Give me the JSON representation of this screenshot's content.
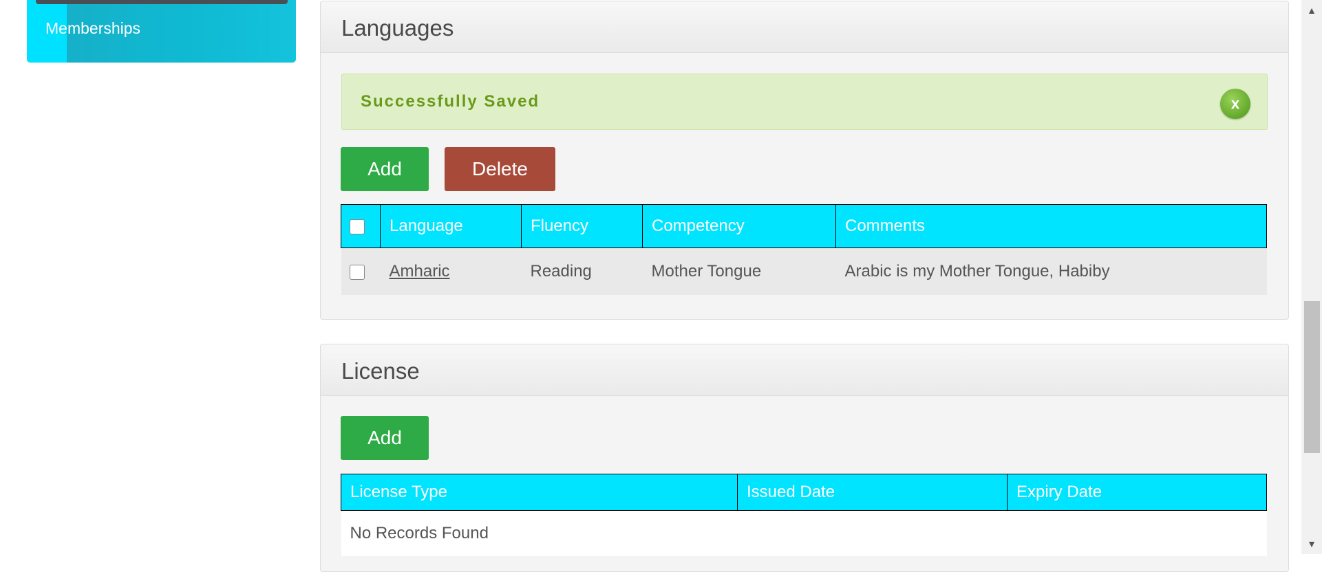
{
  "sidebar": {
    "items": [
      {
        "label": "Memberships"
      }
    ]
  },
  "languages": {
    "title": "Languages",
    "alert": {
      "message": "Successfully Saved",
      "close_symbol": "x"
    },
    "add_label": "Add",
    "delete_label": "Delete",
    "columns": [
      "",
      "Language",
      "Fluency",
      "Competency",
      "Comments"
    ],
    "rows": [
      {
        "language": "Amharic",
        "fluency": "Reading",
        "competency": "Mother Tongue",
        "comments": "Arabic is my Mother Tongue, Habiby"
      }
    ]
  },
  "license": {
    "title": "License",
    "add_label": "Add",
    "columns": [
      "License Type",
      "Issued Date",
      "Expiry Date"
    ],
    "empty_message": "No Records Found"
  },
  "colors": {
    "table_header": "#00e4ff",
    "add_button": "#2eab46",
    "delete_button": "#a84a3a",
    "success_bg": "#dff0c8",
    "success_text": "#6a9a1a"
  }
}
